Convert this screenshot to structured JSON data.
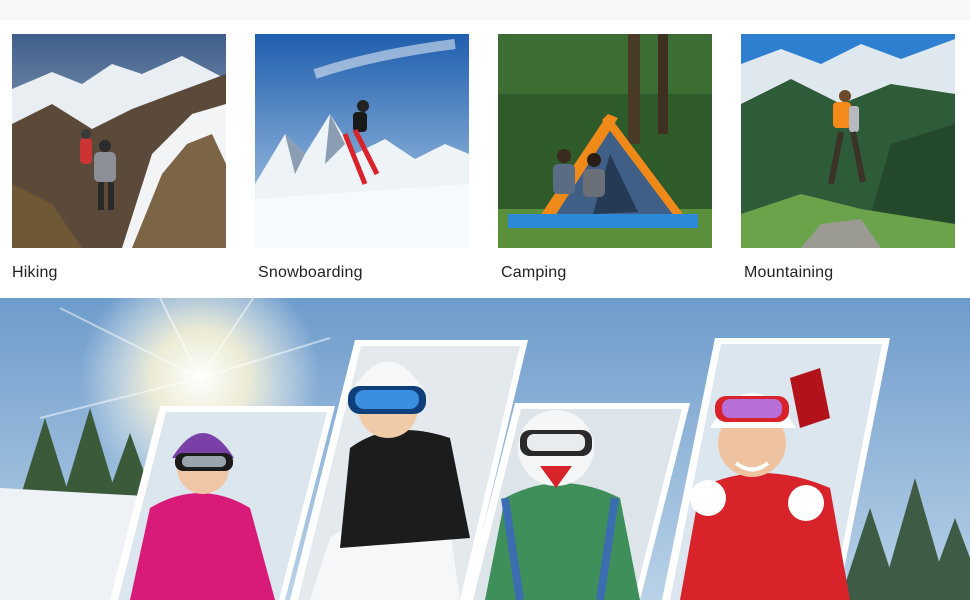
{
  "activities": [
    {
      "label": "Hiking",
      "scene": "hiking-photo"
    },
    {
      "label": "Snowboarding",
      "scene": "snowboarding-photo"
    },
    {
      "label": "Camping",
      "scene": "camping-photo"
    },
    {
      "label": "Mountaining",
      "scene": "mountaineering-photo"
    }
  ],
  "banner": {
    "scene": "winter-goggles-banner",
    "people": [
      "woman-pink-jacket",
      "woman-black-jacket",
      "person-white-helmet",
      "woman-red-jacket"
    ]
  },
  "colors": {
    "caption_text": "#222222",
    "sky_blue": "#7fb0dc",
    "snow": "#eef2f6",
    "pink_jacket": "#d81b78",
    "red_jacket": "#d8232a",
    "green_jacket": "#3f8f5a"
  }
}
